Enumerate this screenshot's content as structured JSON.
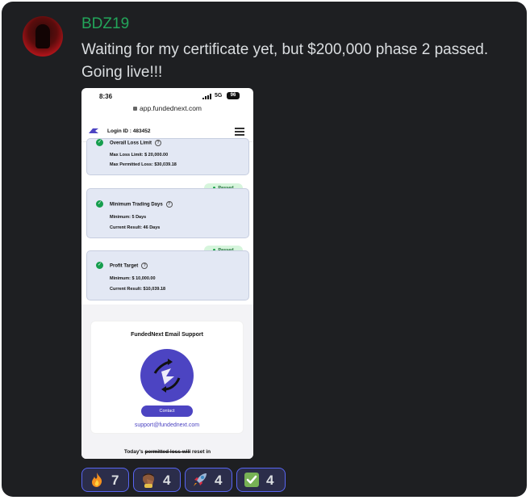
{
  "message": {
    "username": "BDZ19",
    "text": "Waiting for my certificate yet, but $200,000 phase 2 passed. Going live!!!"
  },
  "phone": {
    "time": "8:36",
    "network": "5G",
    "battery": "96",
    "url": "app.fundednext.com",
    "login_id": "Login ID : 483452",
    "cards": [
      {
        "title": "Overall Loss Limit",
        "lines": [
          "Max Loss Limit: $ 20,000.00",
          "Max Permitted Loss: $30,039.18"
        ]
      },
      {
        "badge": "Passed",
        "title": "Minimum Trading Days",
        "lines": [
          "Minimum: 5 Days",
          "Current Result: 46 Days"
        ]
      },
      {
        "badge": "Passed",
        "title": "Profit Target",
        "lines": [
          "Minimum: $ 10,000.00",
          "Current Result: $10,039.18"
        ]
      }
    ],
    "support": {
      "title": "FundedNext Email Support",
      "button": "Contact",
      "email": "support@fundednext.com"
    },
    "footer_prefix": "Today's",
    "footer_struck": "permitted loss will",
    "footer_suffix": " reset in"
  },
  "reactions": [
    {
      "icon": "fire-emoji",
      "count": "7"
    },
    {
      "icon": "person-facepalm-emoji",
      "count": "4"
    },
    {
      "icon": "rocket-emoji",
      "count": "4"
    },
    {
      "icon": "check-mark-button-emoji",
      "count": "4"
    }
  ],
  "colors": {
    "background": "#1e1f22",
    "username": "#23a55a",
    "reaction_border": "#5865f2",
    "accent_purple": "#4c44c2",
    "passed_green": "#169e4e"
  }
}
